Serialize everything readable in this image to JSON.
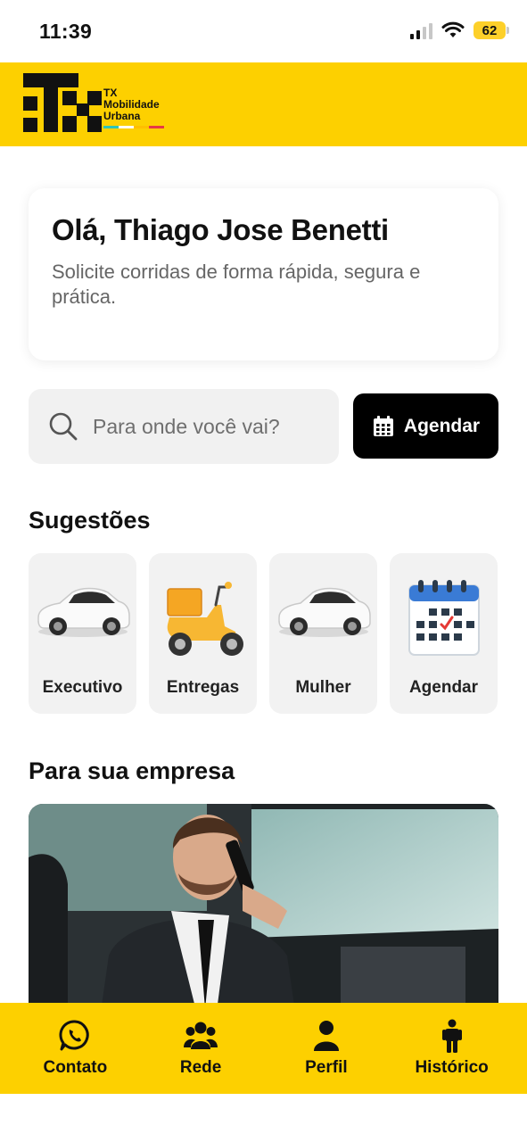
{
  "status_bar": {
    "time": "11:39",
    "battery": "62"
  },
  "header": {
    "logo_text": [
      "TX",
      "Mobilidade",
      "Urbana"
    ],
    "stripe_colors": [
      "#2ec4b6",
      "#ffffff",
      "#ffbf00",
      "#e63946"
    ]
  },
  "greeting": {
    "title": "Olá, Thiago Jose Benetti",
    "subtitle": "Solicite corridas de forma rápida, segura e prática."
  },
  "search": {
    "placeholder": "Para onde você vai?"
  },
  "schedule_button": {
    "label": "Agendar"
  },
  "suggestions": {
    "title": "Sugestões",
    "items": [
      {
        "label": "Executivo",
        "icon": "white-car-icon"
      },
      {
        "label": "Entregas",
        "icon": "delivery-scooter-icon"
      },
      {
        "label": "Mulher",
        "icon": "white-car-icon"
      },
      {
        "label": "Agendar",
        "icon": "calendar-icon"
      }
    ]
  },
  "business": {
    "title": "Para sua empresa"
  },
  "bottom_nav": {
    "items": [
      {
        "label": "Contato",
        "icon": "whatsapp-icon"
      },
      {
        "label": "Rede",
        "icon": "group-icon"
      },
      {
        "label": "Perfil",
        "icon": "person-icon"
      },
      {
        "label": "Histórico",
        "icon": "standing-person-icon"
      }
    ]
  },
  "colors": {
    "brand_yellow": "#fdd000",
    "button_black": "#000000"
  }
}
